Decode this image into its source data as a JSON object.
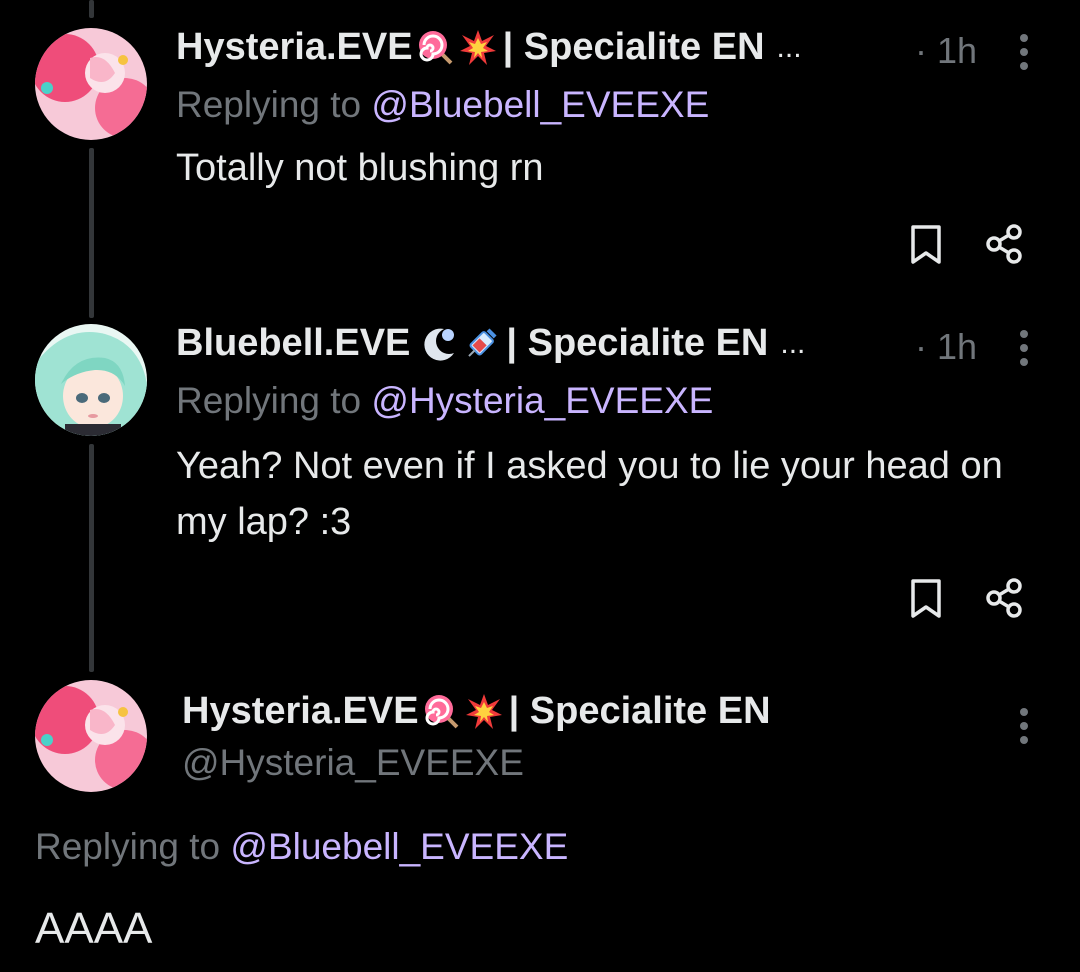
{
  "tweets": [
    {
      "display_name": "Hysteria.EVE",
      "emojis": [
        "lollipop-emoji",
        "collision-emoji"
      ],
      "org": "| Specialite EN",
      "truncation": "...",
      "time": "· 1h",
      "replying_prefix": "Replying to ",
      "replying_handle": "@Bluebell_EVEEXE",
      "text": "Totally not blushing rn"
    },
    {
      "display_name": "Bluebell.EVE",
      "emojis": [
        "moon-emoji",
        "syringe-emoji"
      ],
      "org": "| Specialite EN",
      "truncation": "...",
      "time": "· 1h",
      "replying_prefix": "Replying to ",
      "replying_handle": "@Hysteria_EVEEXE",
      "text": "Yeah? Not even if I asked you to lie your head on my lap? :3"
    }
  ],
  "focused": {
    "display_name": "Hysteria.EVE",
    "emojis": [
      "lollipop-emoji",
      "collision-emoji"
    ],
    "org": "| Specialite EN",
    "handle": "@Hysteria_EVEEXE",
    "replying_prefix": "Replying to ",
    "replying_handle": "@Bluebell_EVEEXE",
    "text": "AAAA"
  },
  "colors": {
    "background": "#000000",
    "primary_text": "#e7e9ea",
    "secondary_text": "#71767b",
    "link": "#c9b5ff",
    "thread_line": "#333639"
  }
}
